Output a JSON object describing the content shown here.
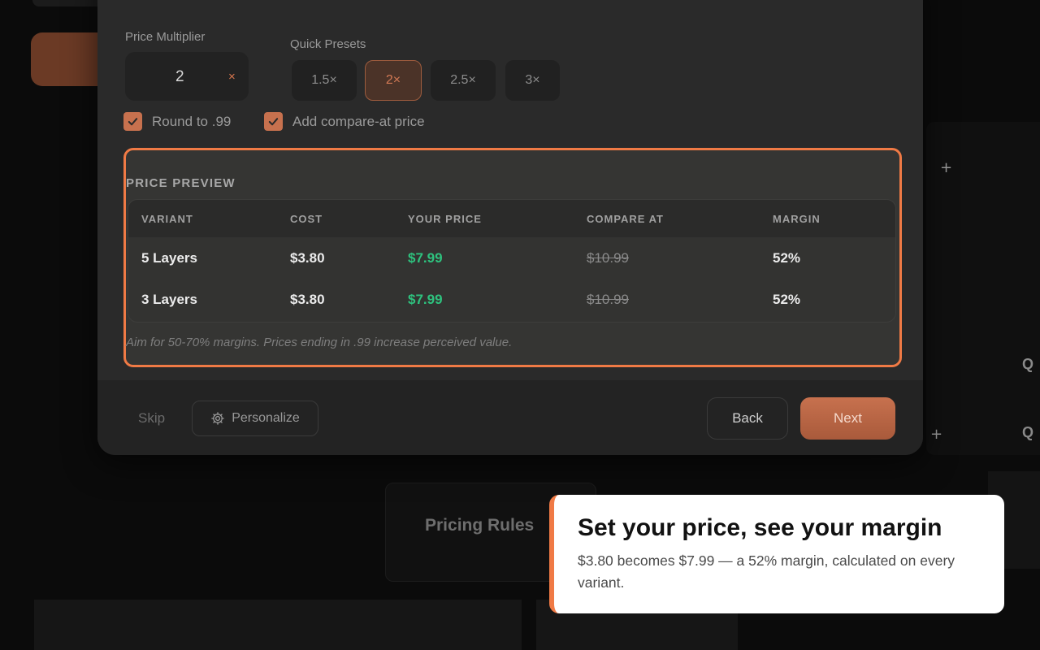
{
  "background": {
    "pricing_card_title": "Pricing Rules",
    "edge_letter": "Q",
    "plus_glyph": "+"
  },
  "modal": {
    "multiplier": {
      "label": "Price Multiplier",
      "value": "2",
      "suffix": "×"
    },
    "presets": {
      "label": "Quick Presets",
      "items": [
        "1.5×",
        "2×",
        "2.5×",
        "3×"
      ],
      "selected": "2×"
    },
    "options": {
      "round_label": "Round to .99",
      "round_checked": true,
      "compare_label": "Add compare-at price",
      "compare_checked": true
    },
    "preview": {
      "title": "PRICE PREVIEW",
      "columns": [
        "VARIANT",
        "COST",
        "YOUR PRICE",
        "COMPARE AT",
        "MARGIN"
      ],
      "rows": [
        {
          "variant": "5 Layers",
          "cost": "$3.80",
          "price": "$7.99",
          "compare": "$10.99",
          "margin": "52%"
        },
        {
          "variant": "3 Layers",
          "cost": "$3.80",
          "price": "$7.99",
          "compare": "$10.99",
          "margin": "52%"
        }
      ],
      "hint": "Aim for 50-70% margins. Prices ending in .99 increase perceived value."
    },
    "footer": {
      "skip_label": "Skip",
      "personalize_label": "Personalize",
      "back_label": "Back",
      "next_label": "Next"
    }
  },
  "callout": {
    "title": "Set your price, see your margin",
    "body": "$3.80 becomes $7.99 — a 52% margin, calculated on every variant."
  },
  "colors": {
    "accent": "#f07a45",
    "next_button": "#c7714e",
    "price_green": "#2ec27e"
  }
}
